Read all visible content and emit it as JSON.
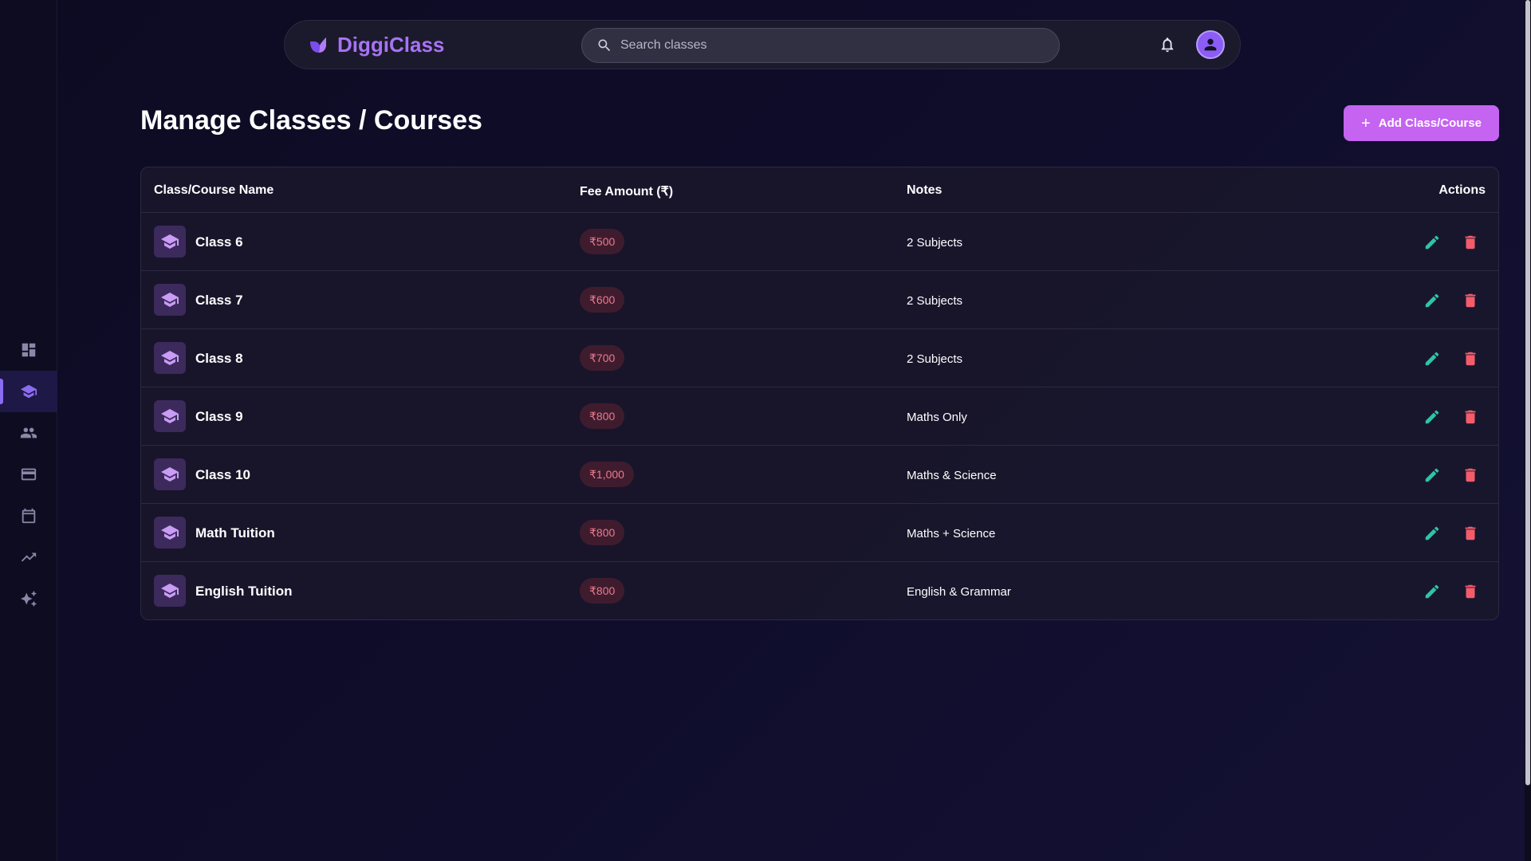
{
  "app": {
    "brand": "DiggiClass"
  },
  "search": {
    "placeholder": "Search classes",
    "value": ""
  },
  "sidebar": {
    "items": [
      {
        "name": "dashboard",
        "icon": "dashboard-icon",
        "active": false
      },
      {
        "name": "classes",
        "icon": "graduation-cap-icon",
        "active": true
      },
      {
        "name": "students",
        "icon": "people-icon",
        "active": false
      },
      {
        "name": "payments",
        "icon": "credit-card-icon",
        "active": false
      },
      {
        "name": "calendar",
        "icon": "calendar-icon",
        "active": false
      },
      {
        "name": "analytics",
        "icon": "trending-up-icon",
        "active": false
      },
      {
        "name": "ai",
        "icon": "sparkles-icon",
        "active": false
      }
    ]
  },
  "page": {
    "title": "Manage Classes / Courses",
    "add_label": "Add Class/Course"
  },
  "table": {
    "headers": {
      "name": "Class/Course Name",
      "fee": "Fee Amount (₹)",
      "notes": "Notes",
      "actions": "Actions"
    },
    "rows": [
      {
        "name": "Class 6",
        "fee": "₹500",
        "notes": "2 Subjects"
      },
      {
        "name": "Class 7",
        "fee": "₹600",
        "notes": "2 Subjects"
      },
      {
        "name": "Class 8",
        "fee": "₹700",
        "notes": "2 Subjects"
      },
      {
        "name": "Class 9",
        "fee": "₹800",
        "notes": "Maths Only"
      },
      {
        "name": "Class 10",
        "fee": "₹1,000",
        "notes": "Maths & Science"
      },
      {
        "name": "Math Tuition",
        "fee": "₹800",
        "notes": "Maths + Science"
      },
      {
        "name": "English Tuition",
        "fee": "₹800",
        "notes": "English & Grammar"
      }
    ]
  },
  "colors": {
    "accent": "#a873f4",
    "button": "#c464f0",
    "edit": "#2fc4a6",
    "delete": "#f25c6b",
    "fee_text": "#ec7a8e"
  }
}
